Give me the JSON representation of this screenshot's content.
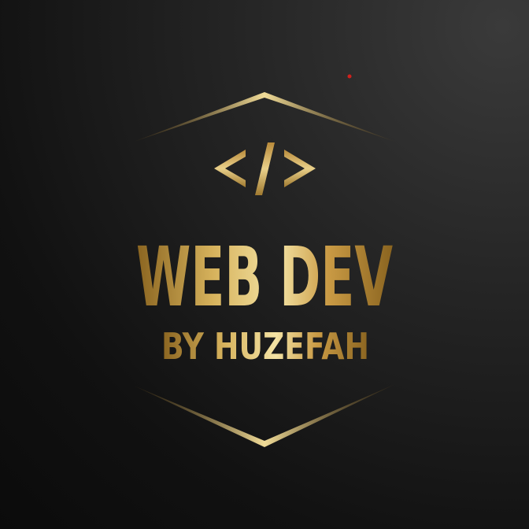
{
  "logo": {
    "title": "WEB DEV",
    "subtitle": "BY HUZEFAH",
    "icon": "code-brackets-icon",
    "colors": {
      "background_dark": "#0b0b0b",
      "background_light": "#3a3a3a",
      "gold_dark": "#8a6420",
      "gold_mid": "#c9a14a",
      "gold_light": "#f4e3a4",
      "red_dot": "#d0201c"
    }
  }
}
